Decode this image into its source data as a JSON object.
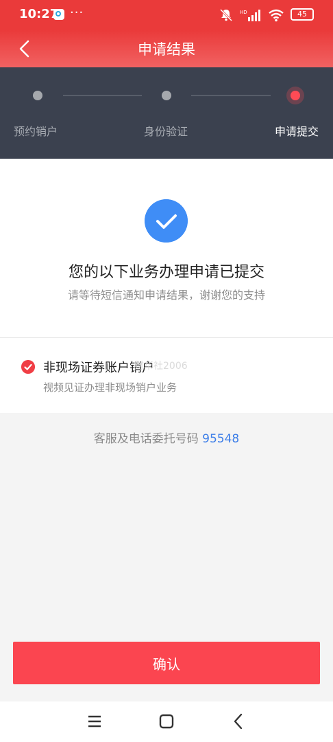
{
  "status_bar": {
    "time": "10:27",
    "dots": "···",
    "battery": "45",
    "icons": [
      "chat-app-icon",
      "bell-muted-icon",
      "signal-icon",
      "wifi-icon",
      "battery-icon"
    ]
  },
  "header": {
    "title": "申请结果",
    "back_icon": "chevron-left-icon"
  },
  "steps": [
    {
      "label": "预约销户",
      "state": "done"
    },
    {
      "label": "身份验证",
      "state": "done"
    },
    {
      "label": "申请提交",
      "state": "active"
    }
  ],
  "result": {
    "icon": "check-circle-icon",
    "title": "您的以下业务办理申请已提交",
    "subtitle": "请等待短信通知申请结果，谢谢您的支持"
  },
  "business_item": {
    "title": "非现场证券账户销户",
    "description": "视频见证办理非现场销户业务",
    "watermark": "财华社2006"
  },
  "hotline": {
    "label": "客服及电话委托号码",
    "number": "95548"
  },
  "confirm_button": {
    "label": "确认"
  },
  "nav_bar": {
    "icons": [
      "menu-icon",
      "home-icon",
      "back-icon"
    ]
  },
  "colors": {
    "brand_red": "#ea3a3a",
    "button_red": "#fb4550",
    "accent_blue": "#3f8df6",
    "steps_bg": "#3b414f"
  }
}
